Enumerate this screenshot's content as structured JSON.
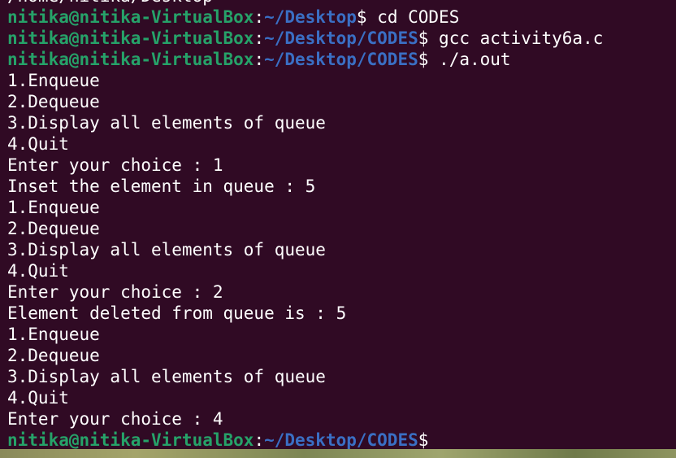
{
  "terminal": {
    "lines": [
      {
        "kind": "output",
        "text": "/home/nitika/Desktop"
      },
      {
        "kind": "prompt",
        "user": "nitika@nitika-VirtualBox",
        "sep": ":",
        "path": "~/Desktop",
        "symbol": "$",
        "command": " cd CODES"
      },
      {
        "kind": "prompt",
        "user": "nitika@nitika-VirtualBox",
        "sep": ":",
        "path": "~/Desktop/CODES",
        "symbol": "$",
        "command": " gcc activity6a.c"
      },
      {
        "kind": "prompt",
        "user": "nitika@nitika-VirtualBox",
        "sep": ":",
        "path": "~/Desktop/CODES",
        "symbol": "$",
        "command": " ./a.out"
      },
      {
        "kind": "output",
        "text": "1.Enqueue"
      },
      {
        "kind": "output",
        "text": "2.Dequeue"
      },
      {
        "kind": "output",
        "text": "3.Display all elements of queue"
      },
      {
        "kind": "output",
        "text": "4.Quit"
      },
      {
        "kind": "output",
        "text": "Enter your choice : 1"
      },
      {
        "kind": "output",
        "text": "Inset the element in queue : 5"
      },
      {
        "kind": "output",
        "text": "1.Enqueue"
      },
      {
        "kind": "output",
        "text": "2.Dequeue"
      },
      {
        "kind": "output",
        "text": "3.Display all elements of queue"
      },
      {
        "kind": "output",
        "text": "4.Quit"
      },
      {
        "kind": "output",
        "text": "Enter your choice : 2"
      },
      {
        "kind": "output",
        "text": "Element deleted from queue is : 5"
      },
      {
        "kind": "output",
        "text": "1.Enqueue"
      },
      {
        "kind": "output",
        "text": "2.Dequeue"
      },
      {
        "kind": "output",
        "text": "3.Display all elements of queue"
      },
      {
        "kind": "output",
        "text": "4.Quit"
      },
      {
        "kind": "output",
        "text": "Enter your choice : 4"
      },
      {
        "kind": "prompt",
        "user": "nitika@nitika-VirtualBox",
        "sep": ":",
        "path": "~/Desktop/CODES",
        "symbol": "$",
        "command": ""
      }
    ]
  },
  "colors": {
    "background": "#300a24",
    "user": "#26a269",
    "path": "#3a6fc4",
    "text": "#ffffff"
  }
}
